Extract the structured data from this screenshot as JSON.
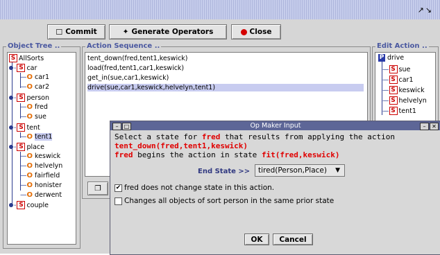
{
  "titlebar": {
    "icons": "↗↘"
  },
  "toolbar": {
    "commit_label": "Commit",
    "generate_label": "Generate Operators",
    "close_label": "Close"
  },
  "object_tree": {
    "title": "Object Tree ..",
    "root": "AllSorts",
    "sorts": [
      {
        "name": "car",
        "objects": [
          "car1",
          "car2"
        ]
      },
      {
        "name": "person",
        "objects": [
          "fred",
          "sue"
        ]
      },
      {
        "name": "tent",
        "objects": [
          "tent1"
        ]
      },
      {
        "name": "place",
        "objects": [
          "keswick",
          "helvelyn",
          "fairfield",
          "honister",
          "derwent"
        ]
      },
      {
        "name": "couple",
        "objects": []
      }
    ]
  },
  "action_sequence": {
    "title": "Action Sequence ..",
    "items": [
      "tent_down(fred,tent1,keswick)",
      "load(fred,tent1,car1,keswick)",
      "get_in(sue,car1,keswick)",
      "drive(sue,car1,keswick,helvelyn,tent1)"
    ]
  },
  "edit_action": {
    "title": "Edit Action ..",
    "action": "drive",
    "args": [
      "sue",
      "car1",
      "keswick",
      "helvelyn",
      "tent1"
    ]
  },
  "dialog": {
    "title": "Op Maker Input",
    "line1_pre": "Select a state for ",
    "line1_obj": "fred",
    "line1_post": " that results from applying the action",
    "line2": "tent_down(fred,tent1,keswick)",
    "line3_obj": "fred",
    "line3_mid": " begins the action in state ",
    "line3_state": "fit(fred,keswick)",
    "end_state_label": "End State >>",
    "end_state_value": "tired(Person,Place)",
    "check1_label": "fred does not change state in this action.",
    "check1_checked": true,
    "check2_label": "Changes all objects of sort person in the same prior state",
    "check2_checked": false,
    "ok_label": "OK",
    "cancel_label": "Cancel"
  },
  "colors": {
    "accent": "#5d6697",
    "sort": "#cc0000",
    "object": "#e46b00",
    "highlight": "#e00000"
  }
}
